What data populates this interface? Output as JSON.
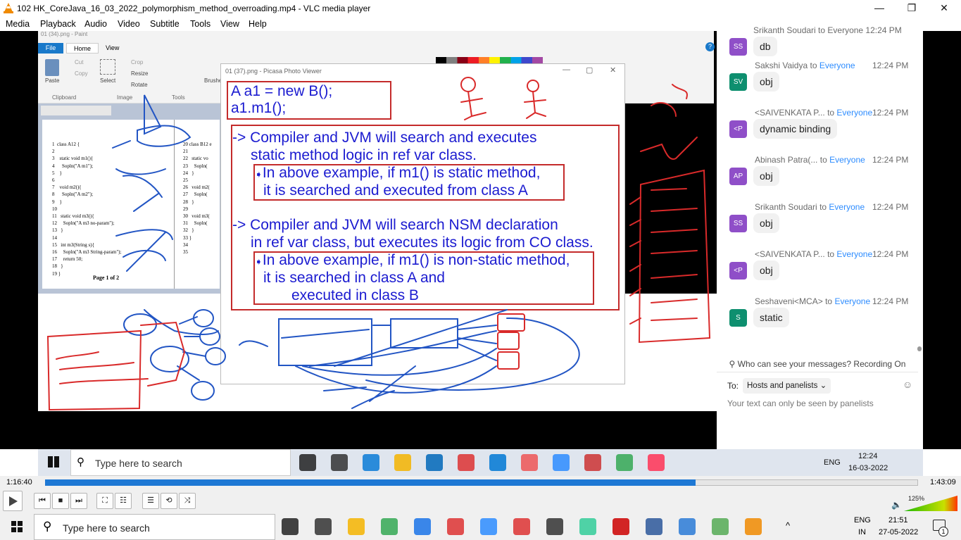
{
  "window": {
    "title": "102 HK_CoreJava_16_03_2022_polymorphism_method_overroading.mp4 - VLC media player",
    "minimize": "—",
    "restore": "❐",
    "close": "✕"
  },
  "menu": [
    "Media",
    "Playback",
    "Audio",
    "Video",
    "Subtitle",
    "Tools",
    "View",
    "Help"
  ],
  "paint": {
    "title": "01 (34).png - Paint",
    "tabs": [
      "File",
      "Home",
      "View"
    ],
    "tools": [
      "Cut",
      "Copy",
      "Paste",
      "Crop",
      "Resize",
      "Rotate",
      "Select",
      "Brushes"
    ],
    "groups": [
      "Clipboard",
      "Image",
      "Tools"
    ],
    "page_label": "Page 1 of 2",
    "code_left": [
      "1  class A12 {",
      "2",
      "3    static void m1(){",
      "4      Sopln(\"A m1\");",
      "5    }",
      "6",
      "7    void m2(){",
      "8      Sopln(\"A m2\");",
      "9    }",
      "10",
      "11   static void m3(){",
      "12     Sopln(\"A m3 no-param\");",
      "13   }",
      "14",
      "15   int m3(String s){",
      "16     Sopln(\"A m3 String-param\");",
      "17     return 50;",
      "18   }",
      "19 }"
    ],
    "code_right": [
      "20 class B12 e",
      "21",
      "22   static vo",
      "23     Sopln(",
      "24   }",
      "25",
      "26   void m2(",
      "27     Sopln(",
      "28   }",
      "29",
      "30   void m3(",
      "31     Sopln(",
      "32   }",
      "33 }",
      "34",
      "35"
    ]
  },
  "picasa": {
    "title": "01 (37).png - Picasa Photo Viewer",
    "code": [
      "A a1 = new B();",
      "a1.m1();"
    ],
    "point1": [
      "-> Compiler and JVM will search and executes",
      "static method logic in ref var class."
    ],
    "point1_sub": [
      "In above example, if m1() is static method,",
      "it is searched and executed from class A"
    ],
    "point2": [
      "-> Compiler and JVM will search  NSM declaration",
      "in ref var class, but executes its logic from CO class."
    ],
    "point2_sub": [
      "In above example, if m1() is non-static method,",
      "it is searched in class A and",
      "executed in class B"
    ]
  },
  "chat": {
    "top_partial": "Srikanth Soudari to Everyone 12:24 PM",
    "messages": [
      {
        "initials": "SS",
        "color": "#8f4fc8",
        "sender": "",
        "to": "",
        "everyone": "",
        "time": "",
        "text": "db"
      },
      {
        "initials": "SV",
        "color": "#0e8f6f",
        "sender": "Sakshi Vaidya",
        "to": "to",
        "everyone": "Everyone",
        "time": "12:24 PM",
        "text": "obj"
      },
      {
        "initials": "<P",
        "color": "#8f4fc8",
        "sender": "<SAIVENKATA P...",
        "to": "to",
        "everyone": "Everyone",
        "time": "12:24 PM",
        "text": "dynamic binding"
      },
      {
        "initials": "AP",
        "color": "#8f4fc8",
        "sender": "Abinash Patra(...",
        "to": "to",
        "everyone": "Everyone",
        "time": "12:24 PM",
        "text": "obj"
      },
      {
        "initials": "SS",
        "color": "#8f4fc8",
        "sender": "Srikanth Soudari",
        "to": "to",
        "everyone": "Everyone",
        "time": "12:24 PM",
        "text": "obj"
      },
      {
        "initials": "<P",
        "color": "#8f4fc8",
        "sender": "<SAIVENKATA P...",
        "to": "to",
        "everyone": "Everyone",
        "time": "12:24 PM",
        "text": "obj"
      },
      {
        "initials": "S",
        "color": "#0e8f6f",
        "sender": "Seshaveni<MCA>",
        "to": "to",
        "everyone": "Everyone",
        "time": "12:24 PM",
        "text": "static"
      }
    ],
    "notice": "Who can see your messages? Recording On",
    "to_label": "To:",
    "recipient": "Hosts and panelists",
    "input_placeholder": "Your text can only be seen by panelists"
  },
  "video_taskbar": {
    "search": "Type here to search",
    "lang": "ENG",
    "time": "12:24",
    "date": "16-03-2022"
  },
  "player": {
    "elapsed": "1:16:40",
    "total": "1:43:09",
    "progress": 0.745,
    "volume": "125%"
  },
  "host_taskbar": {
    "search": "Type here to search",
    "lang": "ENG",
    "region": "IN",
    "time": "21:51",
    "date": "27-05-2022",
    "notification_count": "1"
  }
}
